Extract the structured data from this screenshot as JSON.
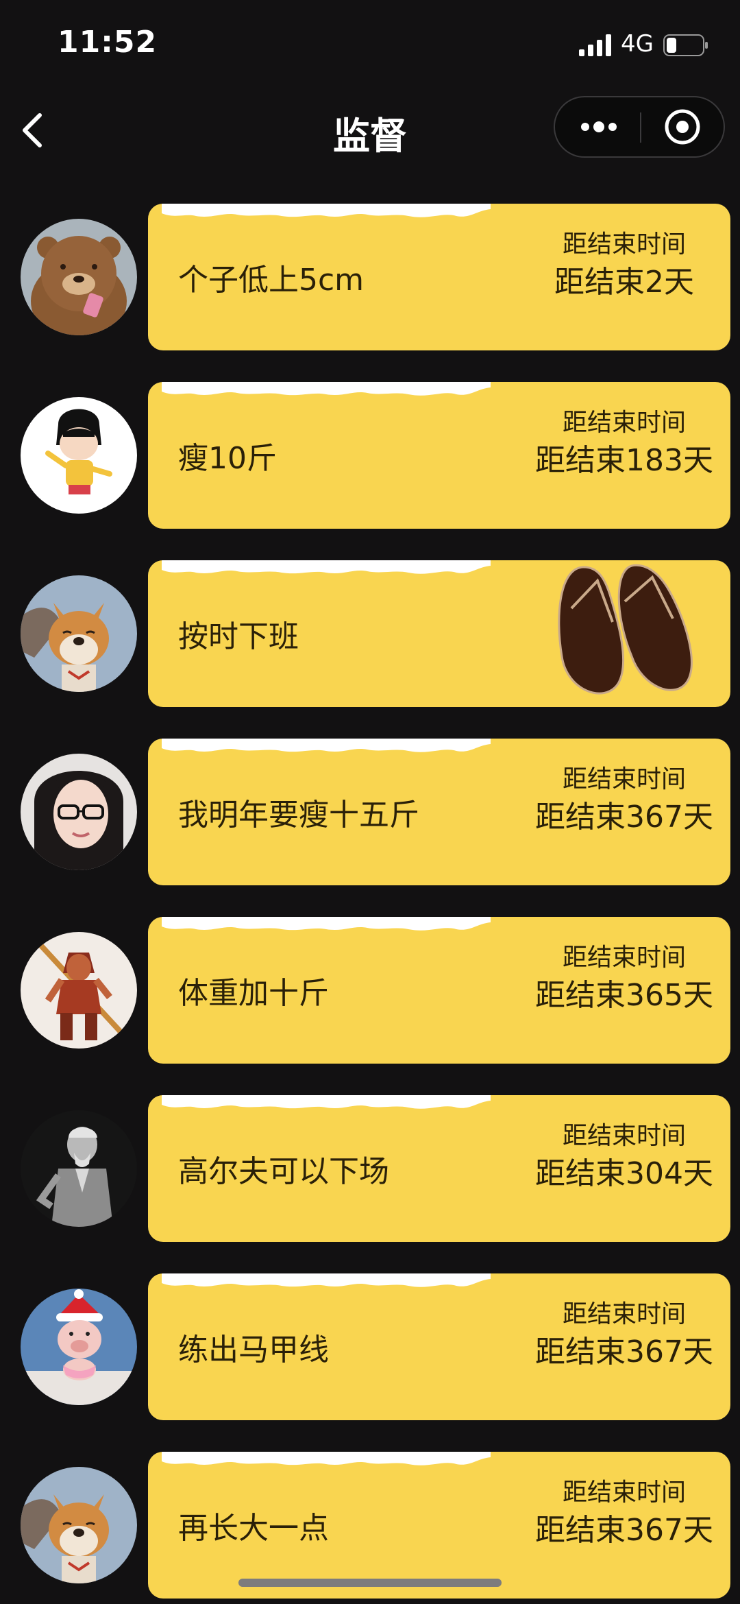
{
  "status_bar": {
    "time": "11:52",
    "network": "4G"
  },
  "nav": {
    "title": "监督"
  },
  "items": [
    {
      "goal": "个子低上5cm",
      "label": "距结束时间",
      "countdown": "距结束2天",
      "avatar": "bear-avatar"
    },
    {
      "goal": "瘦10斤",
      "label": "距结束时间",
      "countdown": "距结束183天",
      "avatar": "cartoon-girl-avatar"
    },
    {
      "goal": "按时下班",
      "label": "",
      "countdown": "",
      "avatar": "shiba-dog-avatar",
      "icon": "slippers-icon"
    },
    {
      "goal": "我明年要瘦十五斤",
      "label": "距结束时间",
      "countdown": "距结束367天",
      "avatar": "woman-glasses-avatar"
    },
    {
      "goal": "体重加十斤",
      "label": "距结束时间",
      "countdown": "距结束365天",
      "avatar": "monkey-king-avatar"
    },
    {
      "goal": "高尔夫可以下场",
      "label": "距结束时间",
      "countdown": "距结束304天",
      "avatar": "old-man-statue-avatar"
    },
    {
      "goal": "练出马甲线",
      "label": "距结束时间",
      "countdown": "距结束367天",
      "avatar": "pig-santa-hat-avatar"
    },
    {
      "goal": "再长大一点",
      "label": "距结束时间",
      "countdown": "距结束367天",
      "avatar": "shiba-dog-avatar"
    }
  ],
  "colors": {
    "background": "#121112",
    "card": "#f9d550",
    "text_dark": "#2a2008"
  }
}
